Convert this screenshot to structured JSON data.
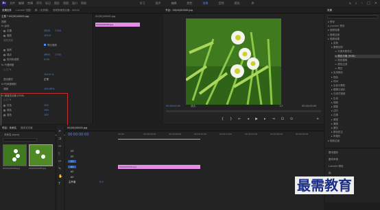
{
  "app": {
    "logo": "Pr"
  },
  "menu": [
    "文件",
    "编辑",
    "剪辑",
    "序列",
    "标记",
    "图形",
    "视图",
    "窗口",
    "帮助"
  ],
  "workspace": [
    "学习",
    "组件",
    "编辑",
    "颜色",
    "效果",
    "音频",
    "图形",
    "库"
  ],
  "effect_controls": {
    "tabs": [
      "效果控件",
      "Lumetri 范围",
      "源：(无剪辑)",
      "音频剪辑混合器：00000"
    ],
    "clip_name": "主要 * 00(00)00000.jpg",
    "seq_name": "00(00)00000.jpg",
    "sections": [
      "视频",
      "fx 运动",
      "位置",
      "缩放",
      "缩放宽度",
      "等比缩放",
      "旋转",
      "锚点",
      "防闪烁滤镜",
      "fx 不透明度",
      "混合模式",
      "fx 时间重映射",
      "速度",
      "fx 通道混合器 (RGB)",
      "○ □ ✎"
    ],
    "values": {
      "pos_x": "2800",
      "pos_y": "1700",
      "scale": "100.0",
      "anchor_x": "2800",
      "anchor_y": "1700",
      "flicker": "0.00",
      "opacity": "100.0 %",
      "blend": "正常",
      "speed": "100.00%"
    },
    "uniform_label": "等比缩放",
    "channel_params": [
      {
        "label": "红色",
        "value": "100"
      },
      {
        "label": "绿色",
        "value": "100"
      },
      {
        "label": "蓝色",
        "value": "100"
      }
    ],
    "timecode": "00:00:00:00",
    "mini_clip": "00(00)00000.jpg"
  },
  "program": {
    "title": "节目：00(00)00000.jpg",
    "timecode_left": "00:00:00:00",
    "fit": "适合",
    "ratio": "1/2",
    "timecode_right": "00:00:05:00"
  },
  "effects_panel": {
    "title": "效果",
    "items": [
      "预设",
      "Lumetri 预设",
      "音频效果",
      "音频过渡",
      "视频效果",
      "变换",
      "图像控制",
      "灰度系数校正",
      "颜色平衡 (RGB)",
      "颜色替换",
      "颜色过滤",
      "黑白",
      "实用程序",
      "扭曲",
      "时间",
      "杂色与颗粒",
      "模糊与锐化",
      "沉浸式视频",
      "生成",
      "视频",
      "调整",
      "过时",
      "过渡",
      "透视",
      "通道",
      "键控",
      "颜色校正",
      "风格化",
      "视频过渡"
    ],
    "bottom": [
      "基本图形",
      "基本声音",
      "Lumetri 颜色",
      "库",
      "标记"
    ]
  },
  "project": {
    "tabs": [
      "项目：未命名",
      "媒体浏览器"
    ],
    "file": "未命名.prproj",
    "search": "",
    "items": [
      {
        "name": "00(00)00000.jpg",
        "dur": "5:00"
      },
      {
        "name": "00(00)00000.jpg",
        "dur": "5:00"
      }
    ]
  },
  "timeline": {
    "tab": "00(00)00000.jpg",
    "timecode": "00:00:00:00",
    "ruler": [
      "00:00",
      "00:00:04:00",
      "00:00:08:00",
      "00:00:12:00",
      "00:00:16:00",
      "00:00:20:00",
      "00:00:24:00",
      "00:00:28:00"
    ],
    "tracks": [
      "V3",
      "V2",
      "V1",
      "A1",
      "A2",
      "A3",
      "主声道"
    ],
    "master_val": "0.0",
    "clip": "00(00)00000.jpg"
  },
  "watermark": "最需教育",
  "colors": {
    "accent": "#4d8df5",
    "clip": "#e58ee8",
    "red_box": "#c0322b"
  }
}
